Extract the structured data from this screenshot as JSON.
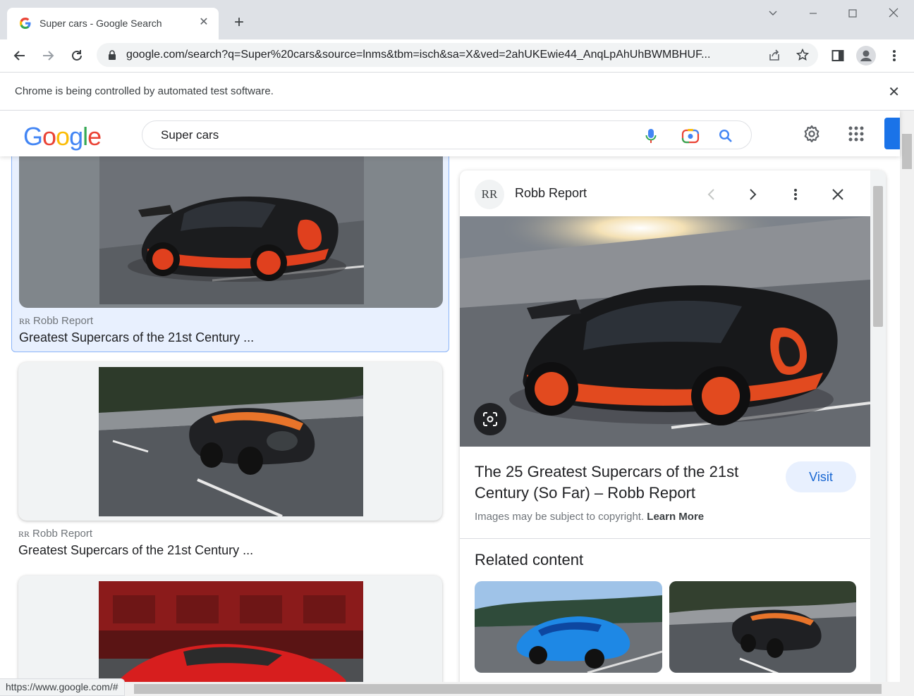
{
  "browser": {
    "tab_title": "Super cars - Google Search",
    "url": "google.com/search?q=Super%20cars&source=lnms&tbm=isch&sa=X&ved=2ahUKEwie44_AnqLpAhUhBWMBHUF...",
    "infobar_text": "Chrome is being controlled by automated test software.",
    "status_url": "https://www.google.com/#"
  },
  "search": {
    "logo": [
      "G",
      "o",
      "o",
      "g",
      "l",
      "e"
    ],
    "query": "Super cars"
  },
  "results": [
    {
      "source_mark": "RR",
      "source": "Robb Report",
      "title": "Greatest Supercars of the 21st Century ..."
    },
    {
      "source_mark": "RR",
      "source": "Robb Report",
      "title": "Greatest Supercars of the 21st Century ..."
    }
  ],
  "panel": {
    "source_mark": "RR",
    "source": "Robb Report",
    "title": "The 25 Greatest Supercars of the 21st Century (So Far) – Robb Report",
    "visit_label": "Visit",
    "copyright_text": "Images may be subject to copyright.",
    "learn_more": "Learn More",
    "related_heading": "Related content"
  },
  "colors": {
    "google_blue": "#4285f4",
    "google_red": "#ea4335",
    "google_yellow": "#fbbc05",
    "google_green": "#34a853",
    "accent": "#1a73e8"
  }
}
